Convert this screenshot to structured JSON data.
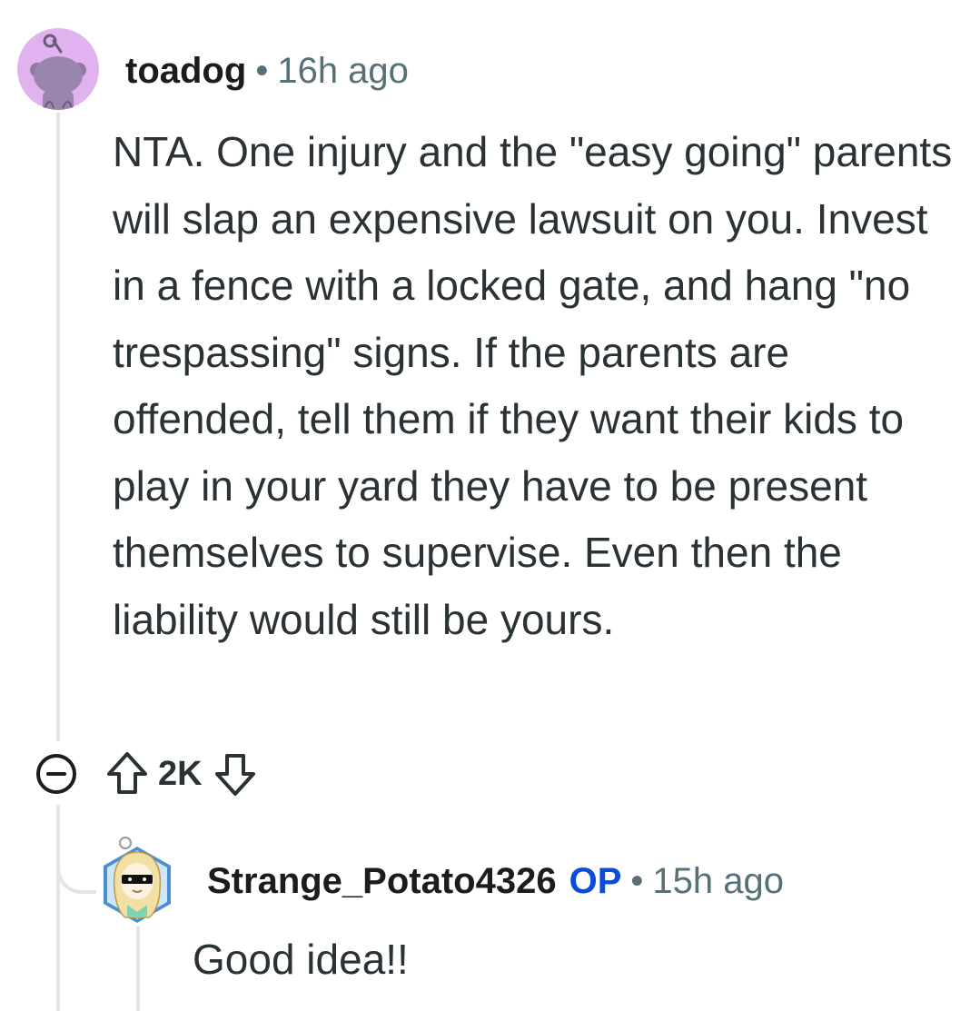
{
  "comment": {
    "username": "toadog",
    "separator": "•",
    "time": "16h ago",
    "body": "NTA. One injury and the \"easy going\" parents will slap an expensive lawsuit on you. Invest in a fence with a locked gate, and hang \"no trespassing\" signs. If the parents are offended, tell them if they want their kids to play in your yard they have to be present themselves to supervise. Even then the liability would still be yours.",
    "score": "2K",
    "icons": {
      "avatar": "snoo-avatar-icon",
      "collapse": "collapse-minus-icon",
      "upvote": "upvote-arrow-icon",
      "downvote": "downvote-arrow-icon"
    }
  },
  "reply": {
    "username": "Strange_Potato4326",
    "op_badge": "OP",
    "separator": "•",
    "time": "15h ago",
    "body": "Good idea!!",
    "icons": {
      "avatar": "custom-avatar-icon"
    }
  },
  "colors": {
    "avatar_bg": "#e0b3f0",
    "op": "#0a4dd6",
    "meta": "#576f76",
    "thread_line": "#e2e4e6"
  }
}
